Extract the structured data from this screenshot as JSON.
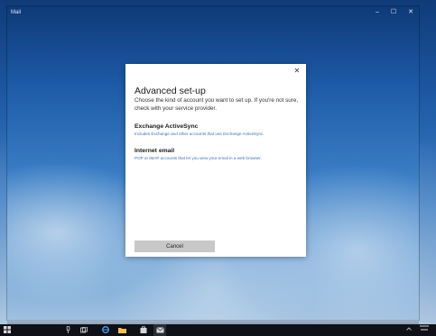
{
  "window": {
    "title": "Mail",
    "controls": {
      "minimize": "–",
      "maximize": "☐",
      "close": "✕"
    }
  },
  "dialog": {
    "close_glyph": "✕",
    "title": "Advanced set-up",
    "description": "Choose the kind of account you want to set up. If you're not sure, check with your service provider.",
    "options": [
      {
        "title": "Exchange ActiveSync",
        "subtitle": "Includes Exchange and other accounts that use Exchange ActiveSync."
      },
      {
        "title": "Internet email",
        "subtitle": "POP or IMAP accounts that let you view your email in a web browser."
      }
    ],
    "cancel_label": "Cancel"
  },
  "taskbar": {
    "icons": {
      "start": "start-icon",
      "search": "microphone-icon",
      "taskview": "task-view-icon",
      "edge": "edge-browser-icon",
      "explorer": "file-explorer-icon",
      "store": "store-icon",
      "mail": "mail-icon"
    }
  },
  "colors": {
    "accent_link": "#3b72b8",
    "cancel_button": "#c8c8c8",
    "taskbar": "#0f1116"
  }
}
